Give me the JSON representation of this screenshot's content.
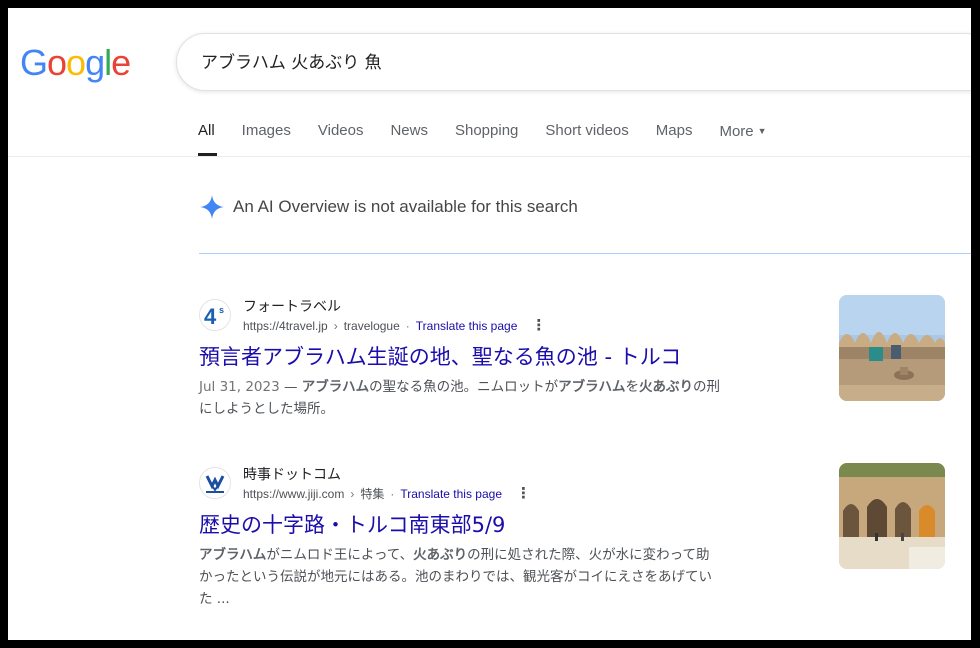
{
  "search": {
    "query": "アブラハム 火あぶり 魚"
  },
  "tabs": [
    {
      "label": "All"
    },
    {
      "label": "Images"
    },
    {
      "label": "Videos"
    },
    {
      "label": "News"
    },
    {
      "label": "Shopping"
    },
    {
      "label": "Short videos"
    },
    {
      "label": "Maps"
    },
    {
      "label": "More"
    }
  ],
  "ai_overview": {
    "text": "An AI Overview is not available for this search"
  },
  "results": [
    {
      "site_name": "フォートラベル",
      "url": "https://4travel.jp",
      "path": "travelogue",
      "translate": "Translate this page",
      "title": "預言者アブラハム生誕の地、聖なる魚の池 - トルコ",
      "date": "Jul 31, 2023",
      "snippet_parts": [
        "アブラハム",
        "の聖なる魚の池。ニムロットが",
        "アブラハム",
        "を",
        "火あぶり",
        "の刑"
      ],
      "snippet_line2": "にしようとした場所。"
    },
    {
      "site_name": "時事ドットコム",
      "url": "https://www.jiji.com",
      "path": "特集",
      "translate": "Translate this page",
      "title": "歴史の十字路・トルコ南東部5/9",
      "snippet_parts": [
        "アブラハム",
        "がニムロド王によって、",
        "火あぶり",
        "の刑に処された際、火が水に変わって助"
      ],
      "snippet_line2": "かったという伝説が地元にはある。池のまわりでは、観光客がコイにえさをあげてい",
      "snippet_line3": "た ..."
    }
  ],
  "colors": {
    "link": "#1a0dab",
    "ai_star": "#4285f4"
  }
}
